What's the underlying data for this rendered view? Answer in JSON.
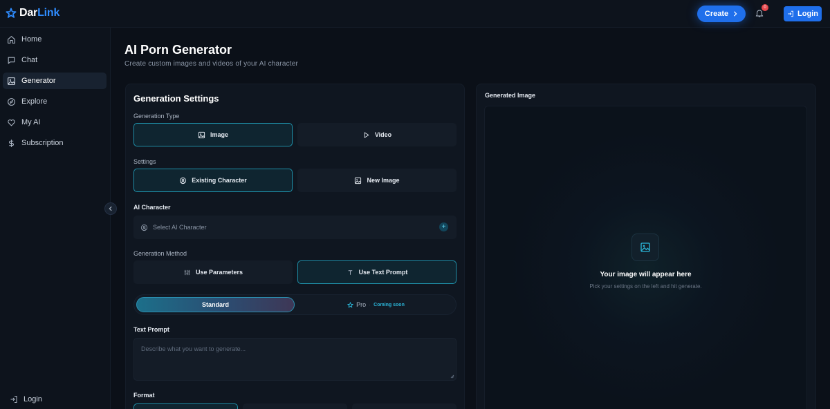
{
  "brand": {
    "name_prefix": "Dar",
    "name_suffix": "Link",
    "accent": "#1f6feb"
  },
  "header": {
    "create_label": "Create",
    "notification_count": "0",
    "login_label": "Login"
  },
  "sidebar": {
    "items": [
      {
        "label": "Home",
        "icon": "home-icon"
      },
      {
        "label": "Chat",
        "icon": "chat-icon"
      },
      {
        "label": "Generator",
        "icon": "image-icon",
        "active": true
      },
      {
        "label": "Explore",
        "icon": "compass-icon"
      },
      {
        "label": "My AI",
        "icon": "heart-icon"
      },
      {
        "label": "Subscription",
        "icon": "dollar-icon"
      }
    ],
    "login_label": "Login"
  },
  "page": {
    "title": "AI Porn Generator",
    "subtitle": "Create custom images and videos of your AI character"
  },
  "settings": {
    "title": "Generation Settings",
    "generation_type_label": "Generation Type",
    "type_image": "Image",
    "type_video": "Video",
    "settings_label": "Settings",
    "existing_character": "Existing Character",
    "new_image": "New Image",
    "ai_character_label": "AI Character",
    "select_character_placeholder": "Select AI Character",
    "generation_method_label": "Generation Method",
    "use_parameters": "Use Parameters",
    "use_text_prompt": "Use Text Prompt",
    "tier_standard": "Standard",
    "tier_pro": "Pro",
    "coming_soon": "Coming soon",
    "text_prompt_label": "Text Prompt",
    "text_prompt_placeholder": "Describe what you want to generate...",
    "format_label": "Format"
  },
  "output": {
    "title": "Generated Image",
    "empty_title": "Your image will appear here",
    "empty_subtitle": "Pick your settings on the left and hit generate."
  }
}
